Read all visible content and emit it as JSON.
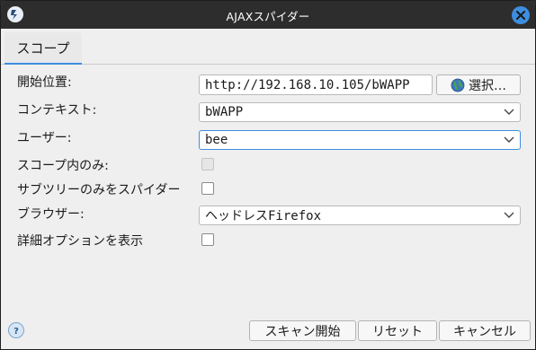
{
  "window": {
    "title": "AJAXスパイダー"
  },
  "tabs": [
    {
      "label": "スコープ"
    }
  ],
  "form": {
    "start_point": {
      "label": "開始位置:",
      "value": "http://192.168.10.105/bWAPP",
      "select_button": "選択…"
    },
    "context": {
      "label": "コンテキスト:",
      "value": "bWAPP"
    },
    "user": {
      "label": "ユーザー:",
      "value": "bee"
    },
    "in_scope_only": {
      "label": "スコープ内のみ:",
      "checked": false,
      "enabled": false
    },
    "spider_subtree": {
      "label": "サブツリーのみをスパイダー",
      "checked": false
    },
    "browser": {
      "label": "ブラウザー:",
      "value": "ヘッドレスFirefox"
    },
    "advanced_options": {
      "label": "詳細オプションを表示",
      "checked": false
    }
  },
  "footer": {
    "start_scan": "スキャン開始",
    "reset": "リセット",
    "cancel": "キャンセル"
  },
  "colors": {
    "accent": "#3d8ee0",
    "titlebar": "#2d2d2d",
    "background": "#efefef"
  },
  "icons": {
    "app": "zap-icon",
    "close": "close-icon",
    "globe": "globe-icon",
    "dropdown": "chevron-down-icon",
    "help": "help-icon"
  }
}
